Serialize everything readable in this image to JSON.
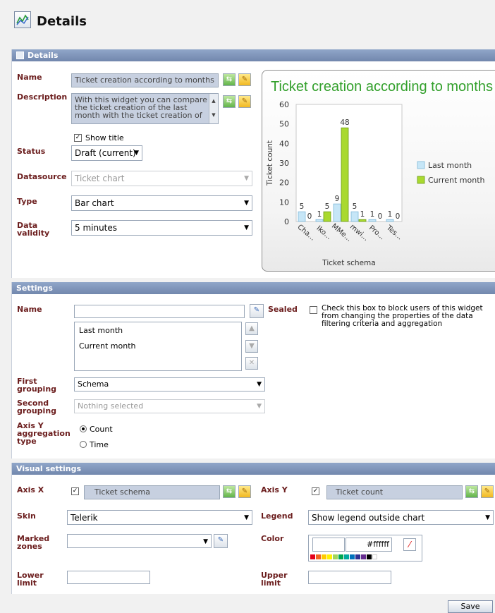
{
  "page": {
    "title": "Details"
  },
  "details": {
    "header": "Details",
    "name_label": "Name",
    "name_value": "Ticket creation according to months",
    "description_label": "Description",
    "description_lines": [
      "With this widget you can compare",
      "the ticket creation of the last",
      "month with the ticket creation of"
    ],
    "show_title_label": "Show title",
    "status_label": "Status",
    "status_value": "Draft (current)",
    "datasource_label": "Datasource",
    "datasource_value": "Ticket chart",
    "type_label": "Type",
    "type_value": "Bar chart",
    "data_validity_label_1": "Data",
    "data_validity_label_2": "validity",
    "data_validity_value": "5 minutes"
  },
  "chart_data": {
    "type": "bar",
    "title": "Ticket creation according to months",
    "xlabel": "Ticket schema",
    "ylabel": "Ticket count",
    "categories": [
      "Cha...",
      "Iko...",
      "MMe...",
      "mwi...",
      "Pro...",
      "Tes..."
    ],
    "series": [
      {
        "name": "Last month",
        "values": [
          5,
          1,
          9,
          5,
          1,
          1
        ],
        "color": "#c6e6f7"
      },
      {
        "name": "Current month",
        "values": [
          0,
          5,
          48,
          1,
          0,
          0
        ],
        "color": "#a9d92f"
      }
    ],
    "ylim": [
      0,
      60
    ],
    "yticks": [
      "0",
      "10",
      "20",
      "30",
      "40",
      "50",
      "60"
    ],
    "grid": false,
    "legend": "right"
  },
  "settings": {
    "header": "Settings",
    "name_label": "Name",
    "name_value": "",
    "sealed_label": "Sealed",
    "sealed_text": [
      "Check this box to block users of this widget",
      "from changing the properties of the data",
      "filtering criteria and aggregation"
    ],
    "series_list": [
      "Last month",
      "Current month"
    ],
    "first_grouping_label": [
      "First",
      "grouping"
    ],
    "first_grouping_value": "Schema",
    "second_grouping_label": [
      "Second",
      "grouping"
    ],
    "second_grouping_value": "Nothing selected",
    "axis_y_agg_label": [
      "Axis Y",
      "aggregation",
      "type"
    ],
    "agg_options": [
      "Count",
      "Time"
    ],
    "agg_selected": "Count"
  },
  "visual": {
    "header": "Visual settings",
    "axis_x_label": "Axis X",
    "axis_x_value": "Ticket schema",
    "axis_y_label": "Axis Y",
    "axis_y_value": "Ticket count",
    "skin_label": "Skin",
    "skin_value": "Telerik",
    "legend_label": "Legend",
    "legend_value": "Show legend outside chart",
    "marked_zones_label": [
      "Marked",
      "zones"
    ],
    "marked_zones_value": "",
    "color_label": "Color",
    "color_value": "#ffffff",
    "palette": [
      "#e4001b",
      "#f26522",
      "#ffcc00",
      "#fff200",
      "#a3d65c",
      "#00a651",
      "#00a99d",
      "#0072bc",
      "#2e3192",
      "#662d91",
      "#000000",
      "#ffffff"
    ],
    "lower_limit_label": [
      "Lower",
      "limit"
    ],
    "upper_limit_label": [
      "Upper",
      "limit"
    ],
    "lower_limit_value": "",
    "upper_limit_value": ""
  },
  "footer": {
    "save_label": "Save"
  }
}
